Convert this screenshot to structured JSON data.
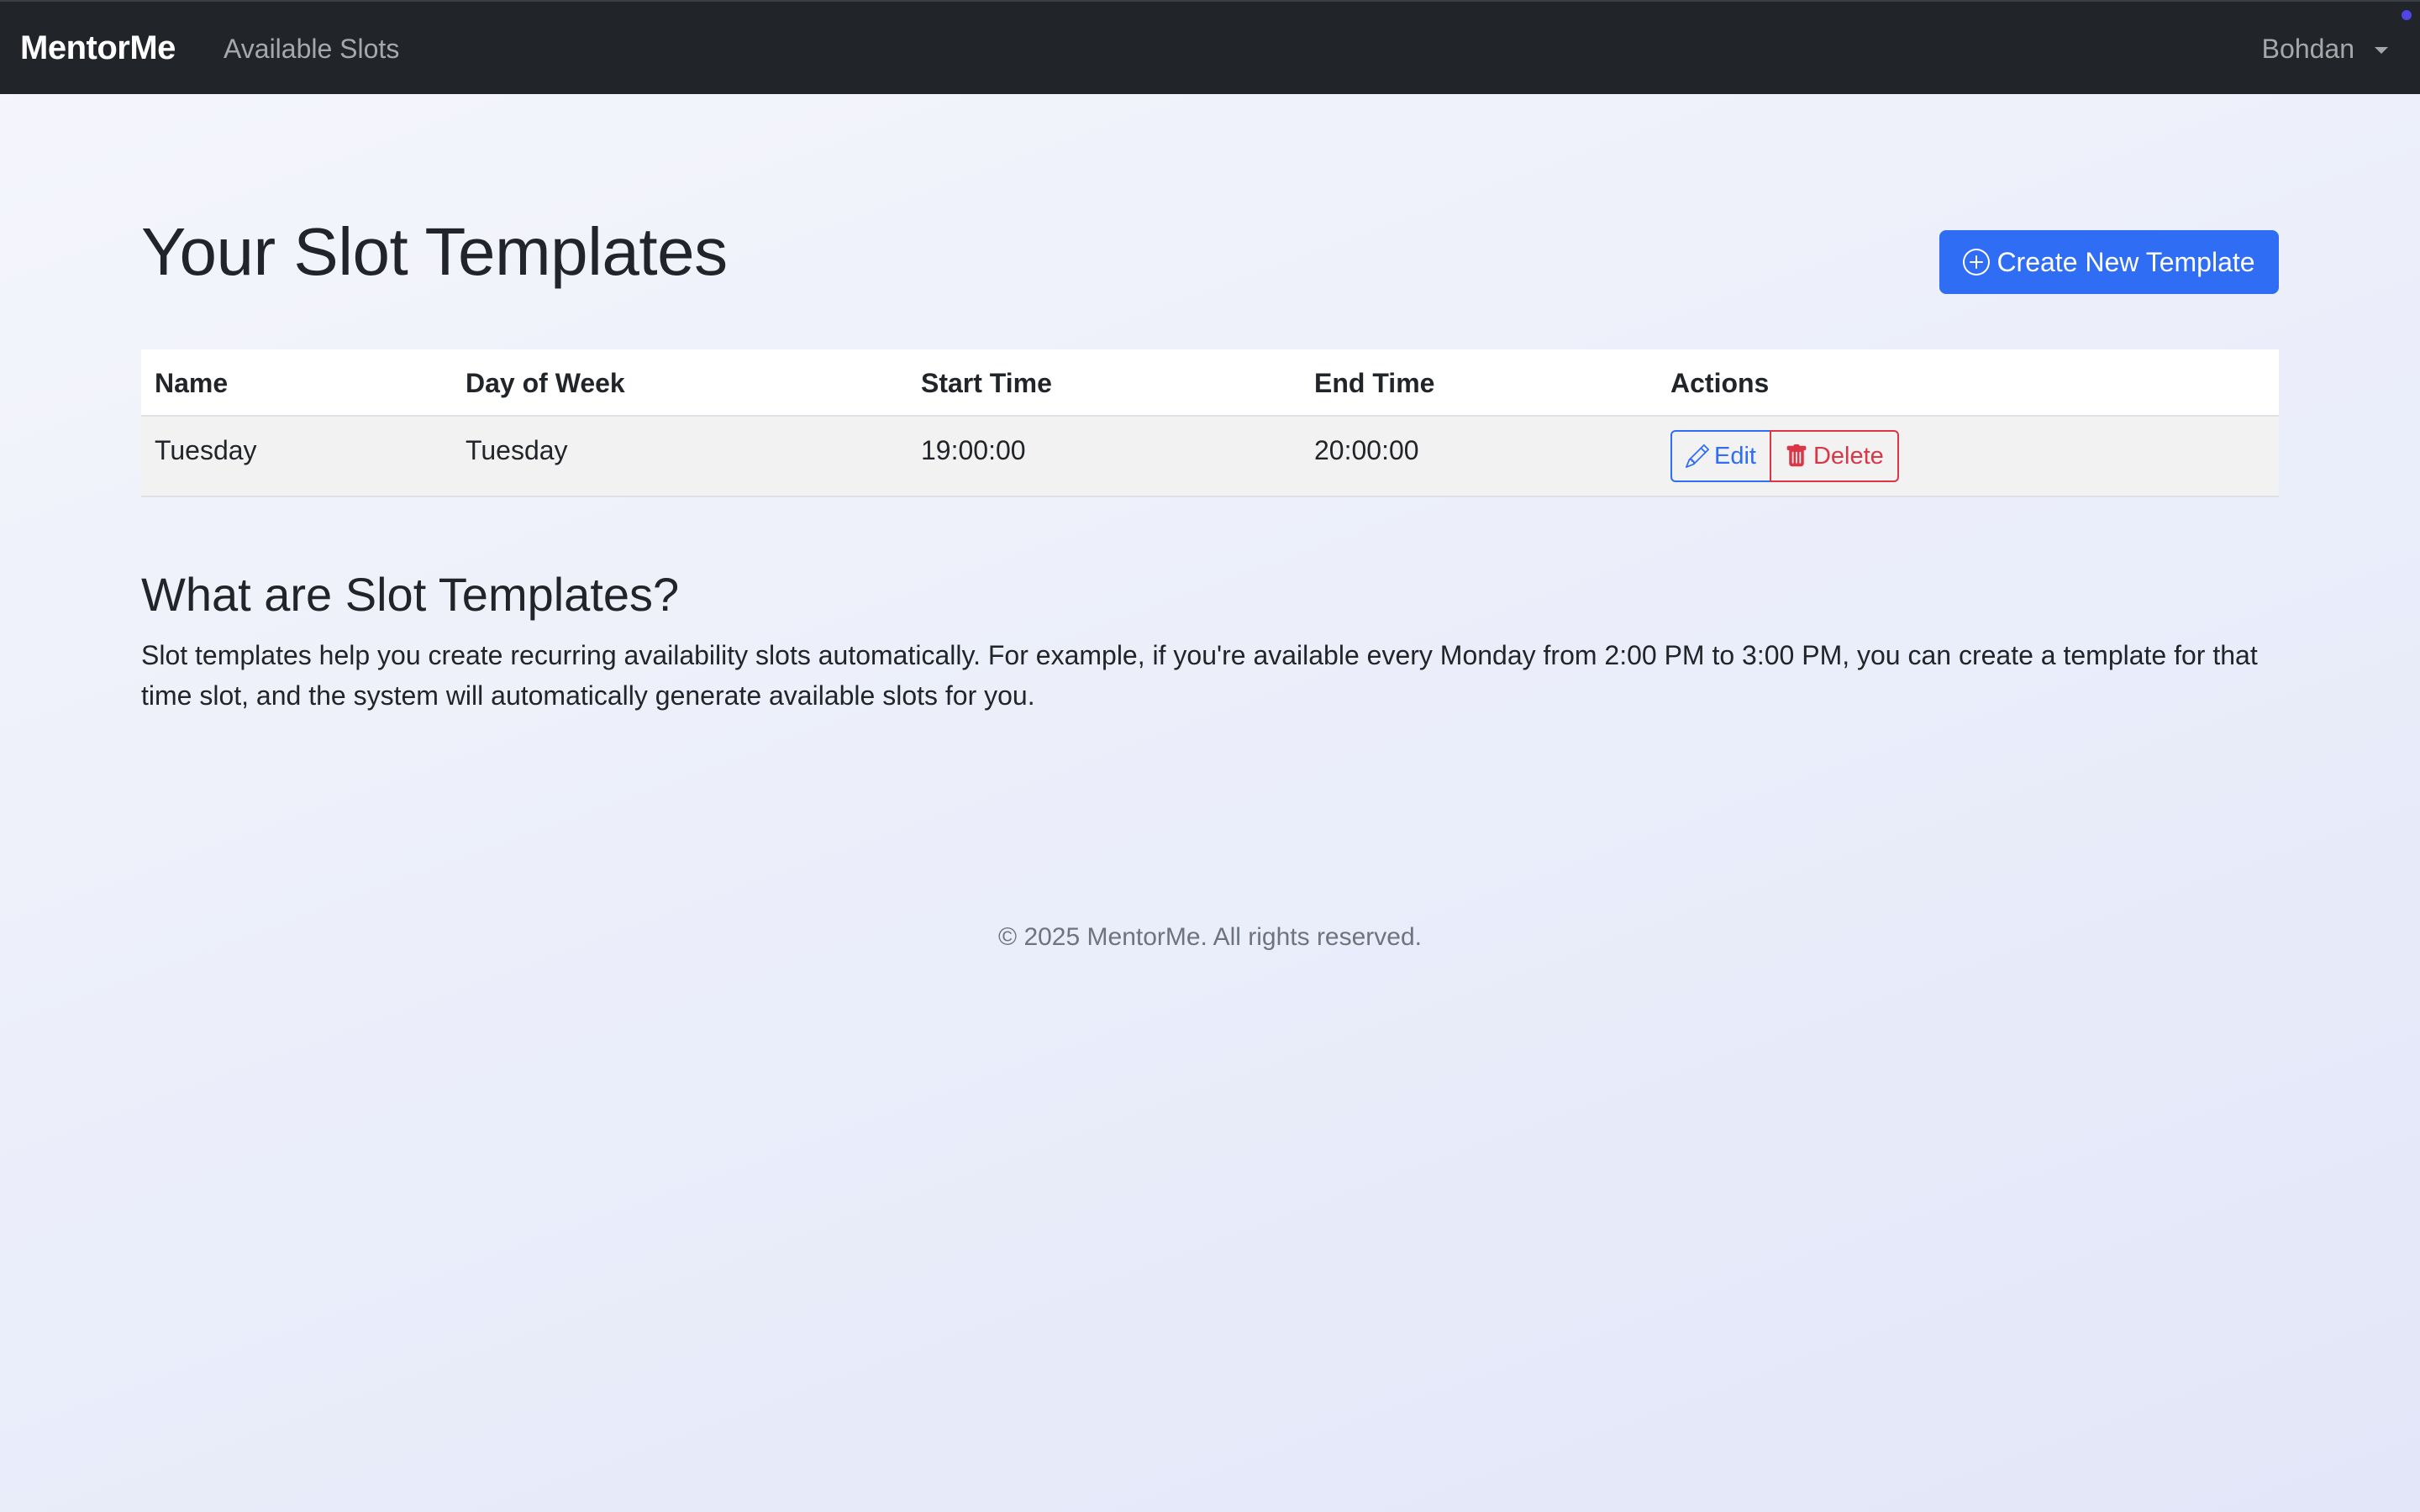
{
  "navbar": {
    "brand": "MentorMe",
    "links": [
      {
        "label": "Available Slots"
      }
    ],
    "user": {
      "name": "Bohdan"
    }
  },
  "header": {
    "title": "Your Slot Templates",
    "create_button_label": "Create New Template"
  },
  "table": {
    "columns": [
      "Name",
      "Day of Week",
      "Start Time",
      "End Time",
      "Actions"
    ],
    "rows": [
      {
        "name": "Tuesday",
        "day_of_week": "Tuesday",
        "start_time": "19:00:00",
        "end_time": "20:00:00",
        "edit_label": "Edit",
        "delete_label": "Delete"
      }
    ]
  },
  "info": {
    "title": "What are Slot Templates?",
    "text": "Slot templates help you create recurring availability slots automatically. For example, if you're available every Monday from 2:00 PM to 3:00 PM, you can create a template for that time slot, and the system will automatically generate available slots for you."
  },
  "footer": {
    "text": "© 2025 MentorMe. All rights reserved."
  },
  "colors": {
    "navbar_bg": "#212529",
    "primary": "#2f6df5",
    "danger": "#dc3545",
    "muted": "#6c757d"
  },
  "icons": {
    "create": "plus-circle-icon",
    "edit": "pencil-icon",
    "delete": "trash-icon",
    "user_menu": "caret-down-icon"
  }
}
